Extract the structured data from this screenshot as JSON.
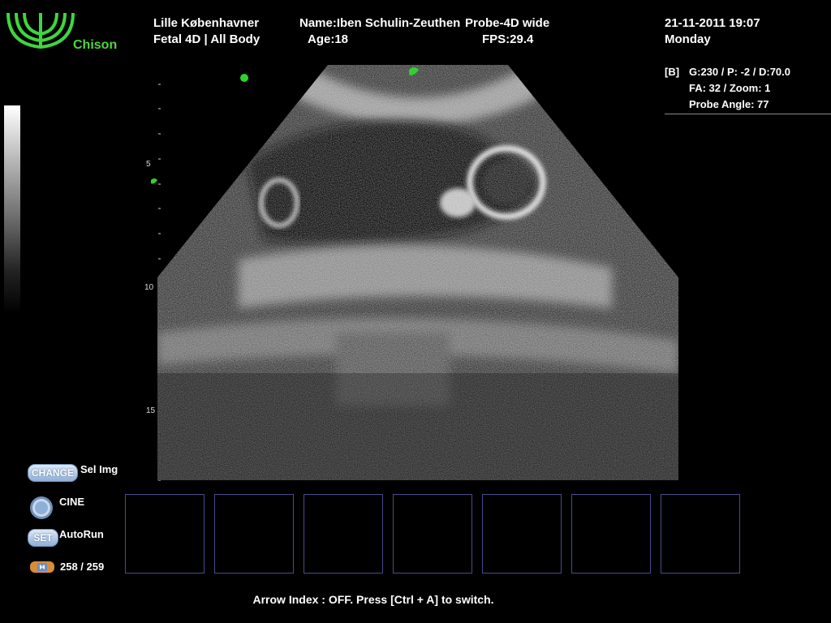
{
  "brand": {
    "name": "Chison"
  },
  "header": {
    "patient_id": "Lille Københavner",
    "exam_type": "Fetal 4D | All Body",
    "name_label": "Name:Iben Schulin-Zeuthen",
    "age_label": "Age:18",
    "probe_label": "Probe-4D   wide",
    "fps_label": "FPS:29.4",
    "datetime": "21-11-2011  19:07",
    "weekday": "Monday"
  },
  "params": {
    "mode": "[B]",
    "line1": "G:230 / P: -2 / D:70.0",
    "line2": "FA: 32 / Zoom:  1",
    "line3": "Probe Angle:  77"
  },
  "depth_scale": {
    "labels": [
      "5",
      "10",
      "15"
    ]
  },
  "controls": {
    "change_button": "CHANGE",
    "sel_img_label": "Sel Img",
    "cine_label": "CINE",
    "set_button": "SET",
    "autorun_label": "AutoRun",
    "frame_counter": "258 / 259"
  },
  "status": {
    "hint": "Arrow Index : OFF. Press [Ctrl + A] to switch."
  },
  "colors": {
    "accent_green": "#2fd22f",
    "thumb_border": "#4a4a8f",
    "button_blue": "#a9c3e4"
  }
}
